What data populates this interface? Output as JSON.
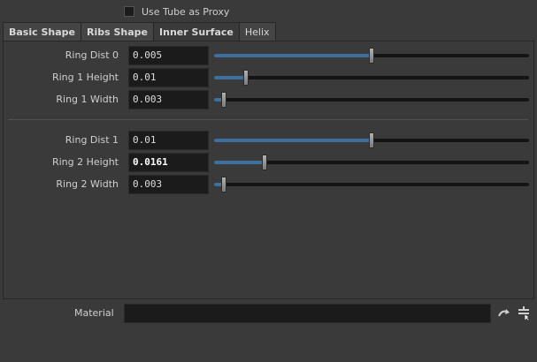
{
  "proxy": {
    "label": "Use Tube as Proxy",
    "checked": false
  },
  "tabs": [
    {
      "label": "Basic Shape",
      "active": false
    },
    {
      "label": "Ribs Shape",
      "active": false
    },
    {
      "label": "Inner Surface",
      "active": true
    },
    {
      "label": "Helix",
      "active": false
    }
  ],
  "params": [
    {
      "label": "Ring Dist 0",
      "value": "0.005",
      "slider_fraction": 0.5
    },
    {
      "label": "Ring 1 Height",
      "value": "0.01",
      "slider_fraction": 0.1
    },
    {
      "label": "Ring 1 Width",
      "value": "0.003",
      "slider_fraction": 0.03
    },
    {
      "label": "Ring Dist 1",
      "value": "0.01",
      "slider_fraction": 0.5
    },
    {
      "label": "Ring 2 Height",
      "value": "0.0161",
      "slider_fraction": 0.16
    },
    {
      "label": "Ring 2 Width",
      "value": "0.003",
      "slider_fraction": 0.03
    }
  ],
  "material": {
    "label": "Material",
    "value": ""
  },
  "icons": {
    "jump": "arrow-jump-icon",
    "chooser": "node-chooser-icon"
  },
  "colors": {
    "slider_fill": "#3f6f9e",
    "background": "#3a3a3a",
    "field": "#1b1b1b"
  }
}
